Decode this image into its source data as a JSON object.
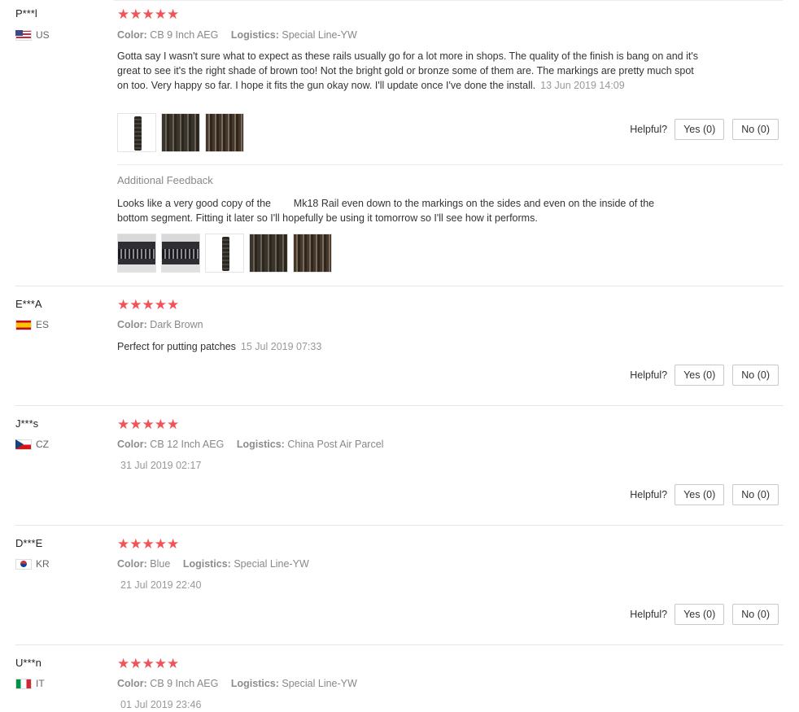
{
  "helpful_label": "Helpful?",
  "stars": "★★★★★",
  "reviews": [
    {
      "user": "P***l",
      "country": "US",
      "attrs": [
        {
          "label": "Color:",
          "value": "CB 9 Inch AEG"
        },
        {
          "label": "Logistics:",
          "value": "Special Line-YW"
        }
      ],
      "text": "Gotta say I wasn't sure what to expect as these rails usually go for a lot more in shops. The quality of the finish is bang on and it's great to see it's the right shade of brown too! Not the bright gold or bronze some of them are. The markings are pretty much spot on too. Very happy so far. I hope it fits the gun okay now. I'll update once I've done the install.",
      "date": "13 Jun 2019 14:09",
      "yes": "Yes (0)",
      "no": "No (0)",
      "additional_title": "Additional Feedback",
      "additional_text": "Looks like a very good copy of the        Mk18 Rail even down to the markings on the sides and even on the inside of the bottom segment. Fitting it later so I'll hopefully be using it tomorrow so I'll see how it performs."
    },
    {
      "user": "E***A",
      "country": "ES",
      "attrs": [
        {
          "label": "Color:",
          "value": "Dark Brown"
        }
      ],
      "text": "Perfect for putting patches",
      "date": "15 Jul 2019 07:33",
      "yes": "Yes (0)",
      "no": "No (0)"
    },
    {
      "user": "J***s",
      "country": "CZ",
      "attrs": [
        {
          "label": "Color:",
          "value": "CB 12 Inch AEG"
        },
        {
          "label": "Logistics:",
          "value": "China Post Air Parcel"
        }
      ],
      "date": "31 Jul 2019 02:17",
      "yes": "Yes (0)",
      "no": "No (0)"
    },
    {
      "user": "D***E",
      "country": "KR",
      "attrs": [
        {
          "label": "Color:",
          "value": "Blue"
        },
        {
          "label": "Logistics:",
          "value": "Special Line-YW"
        }
      ],
      "date": "21 Jul 2019 22:40",
      "yes": "Yes (0)",
      "no": "No (0)"
    },
    {
      "user": "U***n",
      "country": "IT",
      "attrs": [
        {
          "label": "Color:",
          "value": "CB 9 Inch AEG"
        },
        {
          "label": "Logistics:",
          "value": "Special Line-YW"
        }
      ],
      "date": "01 Jul 2019 23:46"
    }
  ]
}
